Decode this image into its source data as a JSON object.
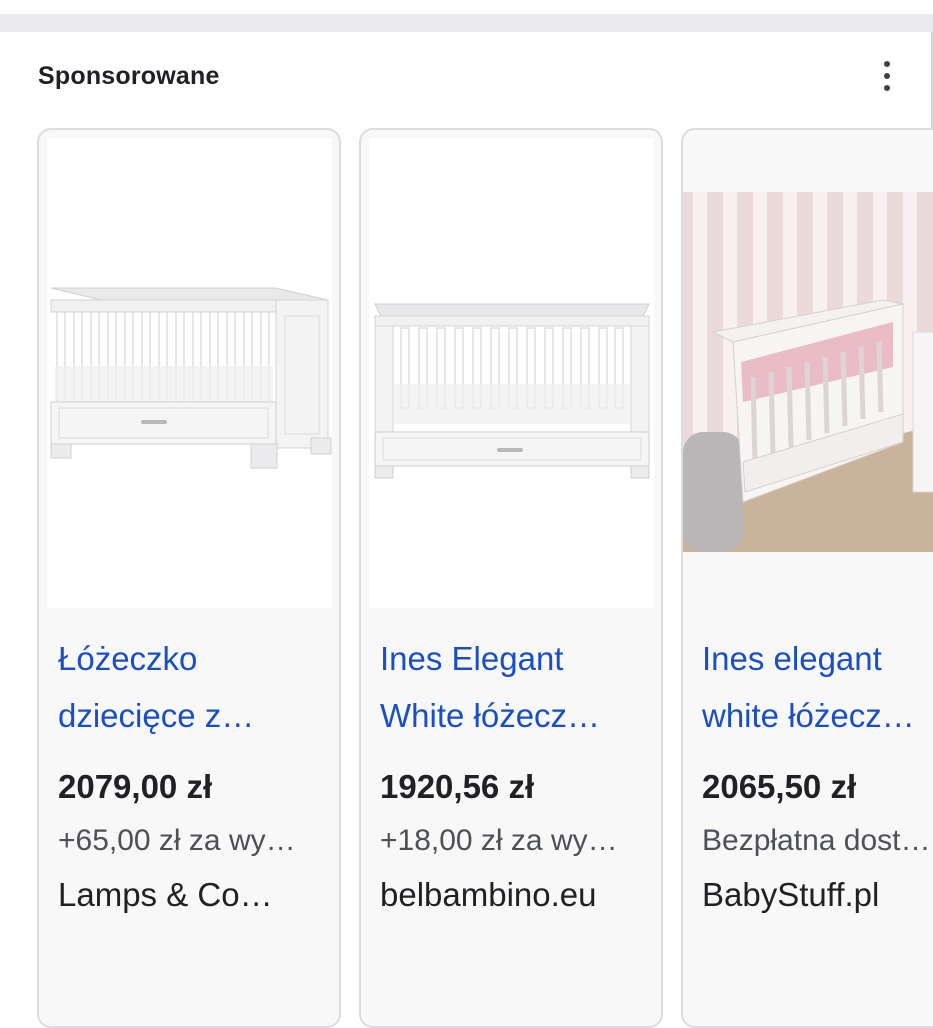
{
  "header": {
    "title": "Sponsorowane",
    "menu_icon": "more-vert-icon"
  },
  "products": [
    {
      "title_line1": "Łóżeczko",
      "title_line2": "dziecięce z…",
      "price": "2079,00 zł",
      "shipping": "+65,00 zł za wy…",
      "store": "Lamps & Co…",
      "image": "white-crib-icon"
    },
    {
      "title_line1": "Ines Elegant",
      "title_line2": "White łóżecz…",
      "price": "1920,56 zł",
      "shipping": "+18,00 zł za wy…",
      "store": "belbambino.eu",
      "image": "white-crib-icon"
    },
    {
      "title_line1": "Ines elegant",
      "title_line2": "white łóżecz…",
      "price": "2065,50 zł",
      "shipping": "Bezpłatna dost…",
      "store": "BabyStuff.pl",
      "image": "crib-in-nursery-photo"
    }
  ],
  "colors": {
    "link": "#1a4fc4",
    "price": "#202124",
    "muted": "#4d5156",
    "card_border": "#dadce0"
  }
}
